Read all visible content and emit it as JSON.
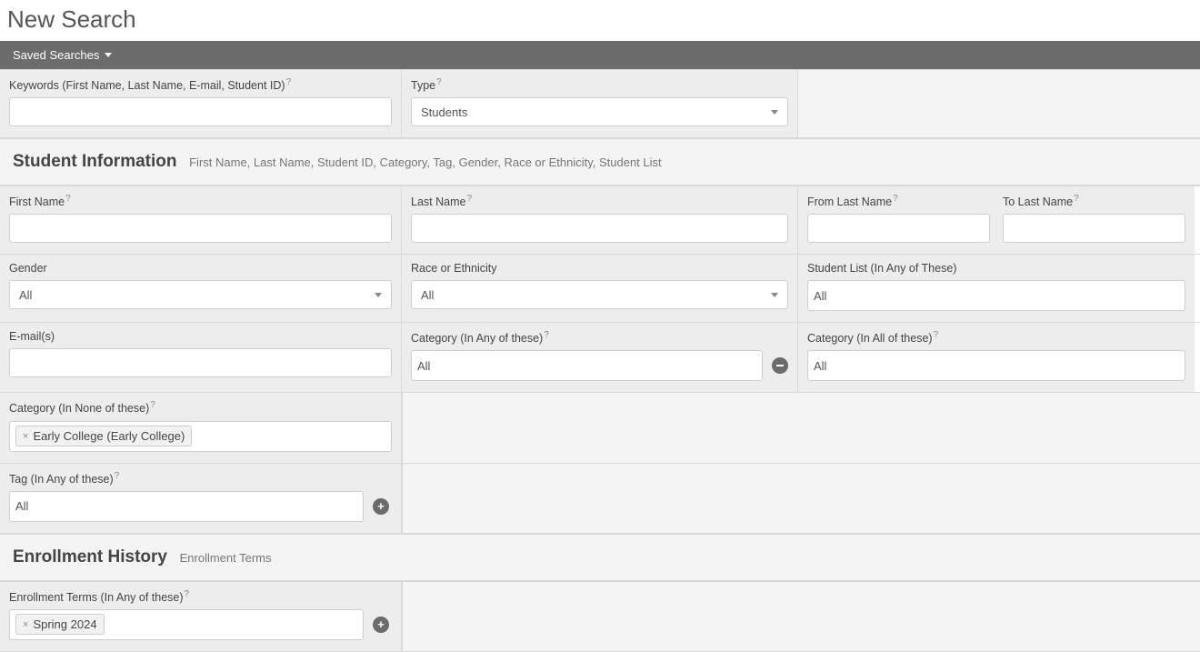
{
  "page_title": "New Search",
  "toolbar": {
    "saved_searches": "Saved Searches"
  },
  "row_keywords": {
    "keywords_label": "Keywords (First Name, Last Name, E-mail, Student ID)",
    "type_label": "Type",
    "type_value": "Students"
  },
  "section_student": {
    "title": "Student Information",
    "subtitle": "First Name, Last Name, Student ID, Category, Tag, Gender, Race or Ethnicity, Student List"
  },
  "row_names": {
    "first_name_label": "First Name",
    "last_name_label": "Last Name",
    "from_last_label": "From Last Name",
    "to_last_label": "To Last Name"
  },
  "row_gre": {
    "gender_label": "Gender",
    "gender_value": "All",
    "race_label": "Race or Ethnicity",
    "race_value": "All",
    "student_list_label": "Student List (In Any of These)",
    "student_list_value": "All"
  },
  "row_ec": {
    "email_label": "E-mail(s)",
    "cat_any_label": "Category (In Any of these)",
    "cat_any_value": "All",
    "cat_all_label": "Category (In All of these)",
    "cat_all_value": "All"
  },
  "row_catnone": {
    "label": "Category (In None of these)",
    "token": "Early College (Early College)"
  },
  "row_tag": {
    "label": "Tag (In Any of these)",
    "value": "All"
  },
  "section_enroll": {
    "title": "Enrollment History",
    "subtitle": "Enrollment Terms"
  },
  "row_terms": {
    "label": "Enrollment Terms (In Any of these)",
    "token": "Spring 2024"
  },
  "qmark": "?"
}
